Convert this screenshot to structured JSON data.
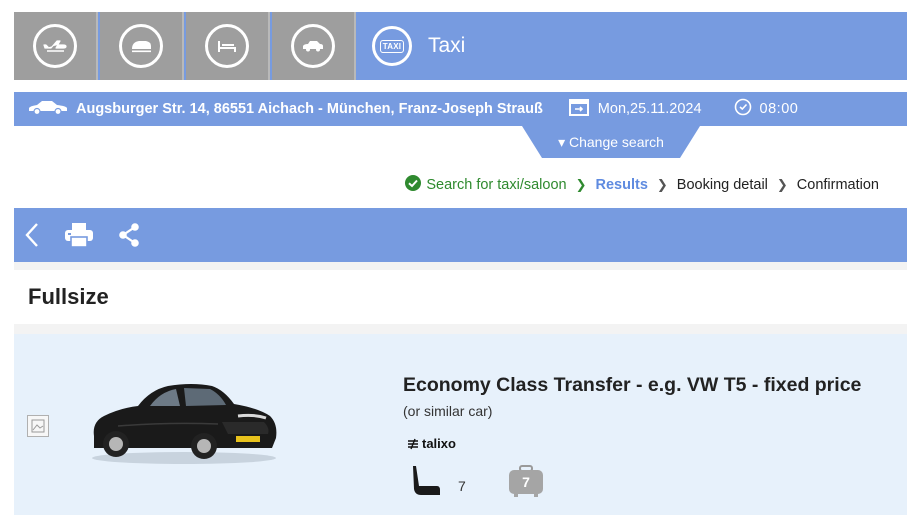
{
  "tabs": [
    {
      "name": "flight",
      "icon": "plane-icon"
    },
    {
      "name": "train",
      "icon": "train-icon"
    },
    {
      "name": "hotel",
      "icon": "bed-icon"
    },
    {
      "name": "car",
      "icon": "car-icon"
    }
  ],
  "active_tab": {
    "chip": "TAXI",
    "label": "Taxi"
  },
  "search": {
    "route": "Augsburger Str. 14, 86551 Aichach - München, Franz-Joseph Strauß",
    "date": "Mon,25.11.2024",
    "time": "08:00",
    "change_label": "▾ Change search"
  },
  "breadcrumb": {
    "step1": "Search for taxi/saloon",
    "step2": "Results",
    "step3": "Booking detail",
    "step4": "Confirmation"
  },
  "category": "Fullsize",
  "result": {
    "title": "Economy Class Transfer - e.g. VW T5 - fixed price",
    "subtitle": "(or similar car)",
    "provider": "talixo",
    "seats": "7",
    "luggage": "7"
  },
  "colors": {
    "accent": "#779be0",
    "tab_grey": "#9e9e9e",
    "card_bg": "#e7f1fb",
    "success": "#2f8a2f",
    "current_step": "#5f8be0"
  }
}
